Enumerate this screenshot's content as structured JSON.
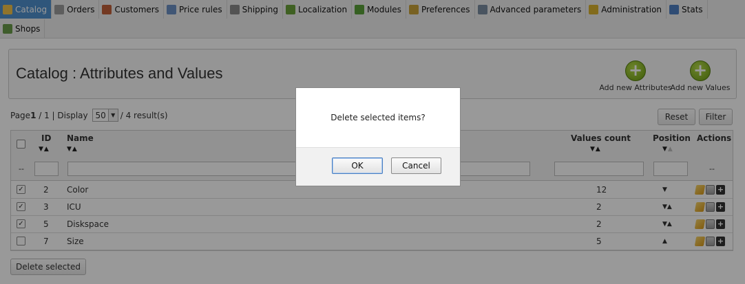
{
  "menu": {
    "row1": [
      {
        "label": "Catalog",
        "icon": "folder-icon",
        "color": "#f0c24a",
        "active": true
      },
      {
        "label": "Orders",
        "icon": "cart-icon",
        "color": "#9c9c9c",
        "active": false
      },
      {
        "label": "Customers",
        "icon": "user-icon",
        "color": "#c0603a",
        "active": false
      },
      {
        "label": "Price rules",
        "icon": "price-tag-icon",
        "color": "#6c8fc4",
        "active": false
      },
      {
        "label": "Shipping",
        "icon": "truck-icon",
        "color": "#8a8a8a",
        "active": false
      },
      {
        "label": "Localization",
        "icon": "globe-icon",
        "color": "#6aa03a",
        "active": false
      },
      {
        "label": "Modules",
        "icon": "puzzle-icon",
        "color": "#5aa13a",
        "active": false
      },
      {
        "label": "Preferences",
        "icon": "preferences-icon",
        "color": "#c9a23a",
        "active": false
      },
      {
        "label": "Advanced parameters",
        "icon": "wrench-icon",
        "color": "#7a8ca0",
        "active": false
      },
      {
        "label": "Administration",
        "icon": "key-icon",
        "color": "#d9b230",
        "active": false
      },
      {
        "label": "Stats",
        "icon": "bar-chart-icon",
        "color": "#4f7fc1",
        "active": false
      }
    ],
    "row2": [
      {
        "label": "Shops",
        "icon": "shop-icon",
        "color": "#6a9c4a",
        "active": false
      }
    ]
  },
  "toolbar": {
    "title": "Catalog : Attributes and Values",
    "add_attributes_label": "Add new Attributes",
    "add_values_label": "Add new Values"
  },
  "pager": {
    "prefix": "Page",
    "page": "1",
    "suffix": " / 1 | Display ",
    "per_page": "50",
    "results": "/ 4 result(s)"
  },
  "buttons": {
    "reset": "Reset",
    "filter": "Filter",
    "delete_selected": "Delete selected"
  },
  "table": {
    "headers": {
      "id": "ID",
      "name": "Name",
      "values_count": "Values count",
      "position": "Position",
      "actions": "Actions"
    },
    "filter_dash_left": "--",
    "filter_dash_right": "--",
    "rows": [
      {
        "checked": true,
        "id": "2",
        "name": "Color",
        "values_count": "12",
        "position": "▼"
      },
      {
        "checked": true,
        "id": "3",
        "name": "ICU",
        "values_count": "2",
        "position": "▼▲"
      },
      {
        "checked": true,
        "id": "5",
        "name": "Diskspace",
        "values_count": "2",
        "position": "▼▲"
      },
      {
        "checked": false,
        "id": "7",
        "name": "Size",
        "values_count": "5",
        "position": "▲"
      }
    ]
  },
  "dialog": {
    "message": "Delete selected items?",
    "ok": "OK",
    "cancel": "Cancel"
  }
}
